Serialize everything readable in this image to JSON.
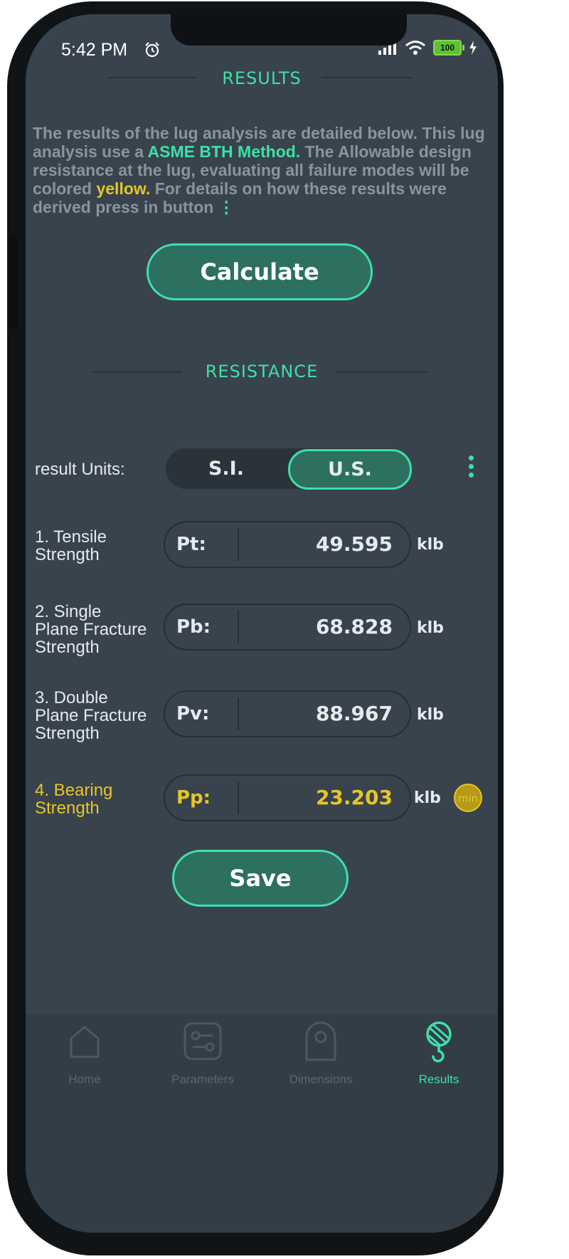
{
  "status_bar": {
    "time": "5:42 PM",
    "battery": "100"
  },
  "results": {
    "title": "RESULTS",
    "desc_1": "The results of the lug analysis are detailed below. This lug analysis use a ",
    "desc_method": "ASME BTH Method.",
    "desc_2": " The Allowable design resistance at the lug, evaluating all failure modes will be colored ",
    "desc_color": "yellow.",
    "desc_3": " For details on how these results were derived press in button ",
    "desc_dots": "⋮",
    "calculate_label": "Calculate"
  },
  "resistance": {
    "title": "RESISTANCE",
    "units_label": "result Units:",
    "unit_options": [
      "S.I.",
      "U.S."
    ],
    "selected_unit": "U.S.",
    "rows": [
      {
        "label_1": "1. Tensile",
        "label_2": "Strength",
        "label_3": "",
        "symbol": "Pt:",
        "value": "49.595",
        "unit": "klb"
      },
      {
        "label_1": "2. Single",
        "label_2": "Plane Fracture",
        "label_3": "Strength",
        "symbol": "Pb:",
        "value": "68.828",
        "unit": "klb"
      },
      {
        "label_1": "3. Double",
        "label_2": "Plane Fracture",
        "label_3": "Strength",
        "symbol": "Pv:",
        "value": "88.967",
        "unit": "klb"
      },
      {
        "label_1": "4. Bearing",
        "label_2": "Strength",
        "label_3": "",
        "symbol": "Pp:",
        "value": "23.203",
        "unit": "klb",
        "badge": "min"
      }
    ],
    "save_label": "Save"
  },
  "nav": {
    "items": [
      {
        "label": "Home",
        "icon": "home-icon"
      },
      {
        "label": "Parameters",
        "icon": "sliders-icon"
      },
      {
        "label": "Dimensions",
        "icon": "lug-icon"
      },
      {
        "label": "Results",
        "icon": "crane-hook-icon"
      }
    ],
    "active": "Results"
  },
  "colors": {
    "accent": "#3ee0a8",
    "highlight": "#e5c62a",
    "background": "#38434d"
  }
}
